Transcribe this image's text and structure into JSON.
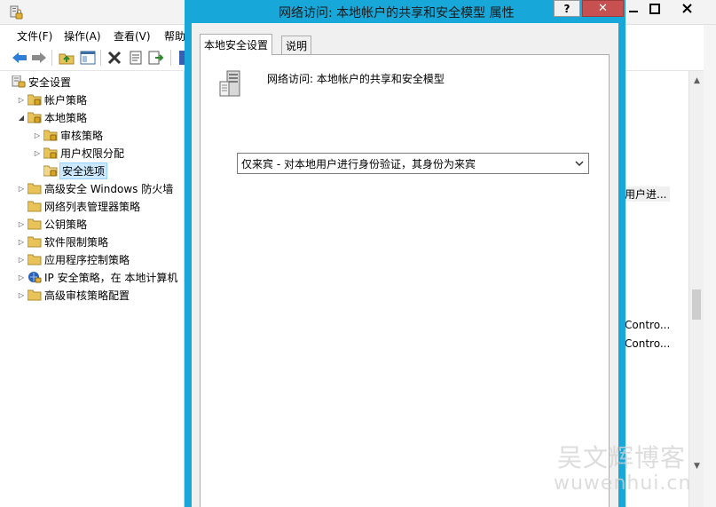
{
  "background_window": {
    "menu": [
      "文件(F)",
      "操作(A)",
      "查看(V)",
      "帮助"
    ],
    "tree": [
      {
        "label": "安全设置",
        "level": 0,
        "arrow": "",
        "icon": "security-settings-icon"
      },
      {
        "label": "帐户策略",
        "level": 1,
        "arrow": "collapsed",
        "icon": "folder-lock-icon"
      },
      {
        "label": "本地策略",
        "level": 1,
        "arrow": "expanded",
        "icon": "folder-lock-icon"
      },
      {
        "label": "审核策略",
        "level": 2,
        "arrow": "collapsed",
        "icon": "folder-lock-icon"
      },
      {
        "label": "用户权限分配",
        "level": 2,
        "arrow": "collapsed",
        "icon": "folder-lock-icon"
      },
      {
        "label": "安全选项",
        "level": 2,
        "arrow": "",
        "icon": "folder-lock-icon",
        "selected": true
      },
      {
        "label": "高级安全 Windows 防火墙",
        "level": 1,
        "arrow": "collapsed",
        "icon": "folder-icon"
      },
      {
        "label": "网络列表管理器策略",
        "level": 1,
        "arrow": "",
        "icon": "folder-icon"
      },
      {
        "label": "公钥策略",
        "level": 1,
        "arrow": "collapsed",
        "icon": "folder-icon"
      },
      {
        "label": "软件限制策略",
        "level": 1,
        "arrow": "collapsed",
        "icon": "folder-icon"
      },
      {
        "label": "应用程序控制策略",
        "level": 1,
        "arrow": "collapsed",
        "icon": "folder-icon"
      },
      {
        "label": "IP 安全策略，在 本地计算机",
        "level": 1,
        "arrow": "collapsed",
        "icon": "ip-security-icon"
      },
      {
        "label": "高级审核策略配置",
        "level": 1,
        "arrow": "collapsed",
        "icon": "folder-icon"
      }
    ],
    "list_fragments": [
      {
        "text": "用户进..."
      },
      {
        "text": "Contro..."
      },
      {
        "text": "Contro..."
      }
    ]
  },
  "dialog": {
    "title": "网络访问: 本地帐户的共享和安全模型 属性",
    "help_label": "?",
    "close_label": "✕",
    "tabs": [
      "本地安全设置",
      "说明"
    ],
    "policy_name": "网络访问: 本地帐户的共享和安全模型",
    "selected_option": "仅来宾 - 对本地用户进行身份验证，其身份为来宾"
  },
  "watermark": {
    "cn": "吴文辉博客",
    "en": "wuwenhui.cn"
  },
  "colors": {
    "dialog_border": "#17a7d8",
    "close_button": "#c75050",
    "selection": "#cce8ff"
  }
}
